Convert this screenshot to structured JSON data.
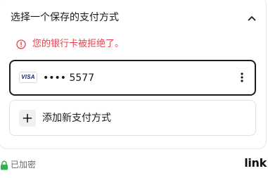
{
  "section": {
    "title": "选择一个保存的支付方式",
    "collapse_icon": "chevron-up-icon"
  },
  "error": {
    "icon": "alert-circle-icon",
    "message": "您的银行卡被拒绝了。",
    "color": "#e5424d"
  },
  "saved_method": {
    "brand": "VISA",
    "masked_number": "•••• 5577",
    "menu_icon": "more-vertical-icon",
    "selected": true
  },
  "add_method": {
    "icon": "plus-icon",
    "label": "添加新支付方式"
  },
  "footer": {
    "lock_icon": "lock-icon",
    "secure_text": "已加密",
    "lock_color": "#33b249",
    "brand_logo": "link"
  }
}
